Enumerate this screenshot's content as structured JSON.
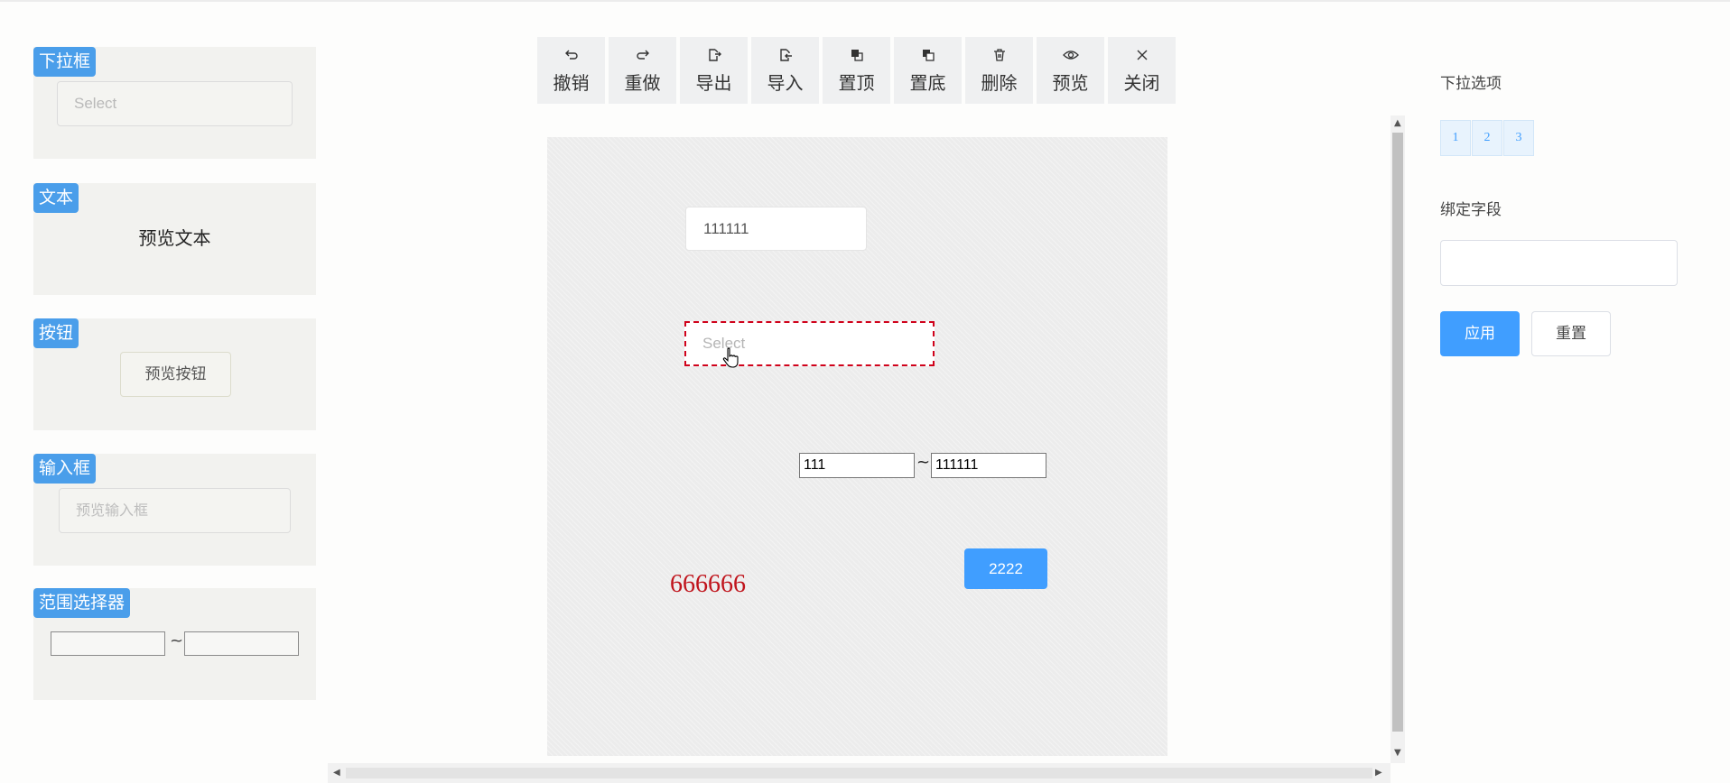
{
  "palette": {
    "select": {
      "tag": "下拉框",
      "placeholder": "Select"
    },
    "text": {
      "tag": "文本",
      "preview": "预览文本"
    },
    "button": {
      "tag": "按钮",
      "preview": "预览按钮"
    },
    "input": {
      "tag": "输入框",
      "placeholder": "预览输入框"
    },
    "range": {
      "tag": "范围选择器",
      "separator": "~"
    }
  },
  "toolbar": {
    "buttons": [
      {
        "label": "撤销",
        "icon": "undo-icon"
      },
      {
        "label": "重做",
        "icon": "redo-icon"
      },
      {
        "label": "导出",
        "icon": "export-icon"
      },
      {
        "label": "导入",
        "icon": "import-icon"
      },
      {
        "label": "置顶",
        "icon": "bring-to-front-icon"
      },
      {
        "label": "置底",
        "icon": "send-to-back-icon"
      },
      {
        "label": "删除",
        "icon": "delete-icon"
      },
      {
        "label": "预览",
        "icon": "eye-icon"
      },
      {
        "label": "关闭",
        "icon": "close-icon"
      }
    ]
  },
  "canvas": {
    "input_value": "111111",
    "select_placeholder": "Select",
    "range": {
      "start": "111",
      "end": "111111",
      "separator": "~"
    },
    "text": "666666",
    "button_label": "2222"
  },
  "panel": {
    "options_label": "下拉选项",
    "options": [
      "1",
      "2",
      "3"
    ],
    "field_label": "绑定字段",
    "field_value": "",
    "apply_label": "应用",
    "reset_label": "重置"
  },
  "colors": {
    "accent": "#409eff",
    "tag": "#4a9eea",
    "selection": "#d0021b",
    "canvas_text": "#c0141c"
  }
}
